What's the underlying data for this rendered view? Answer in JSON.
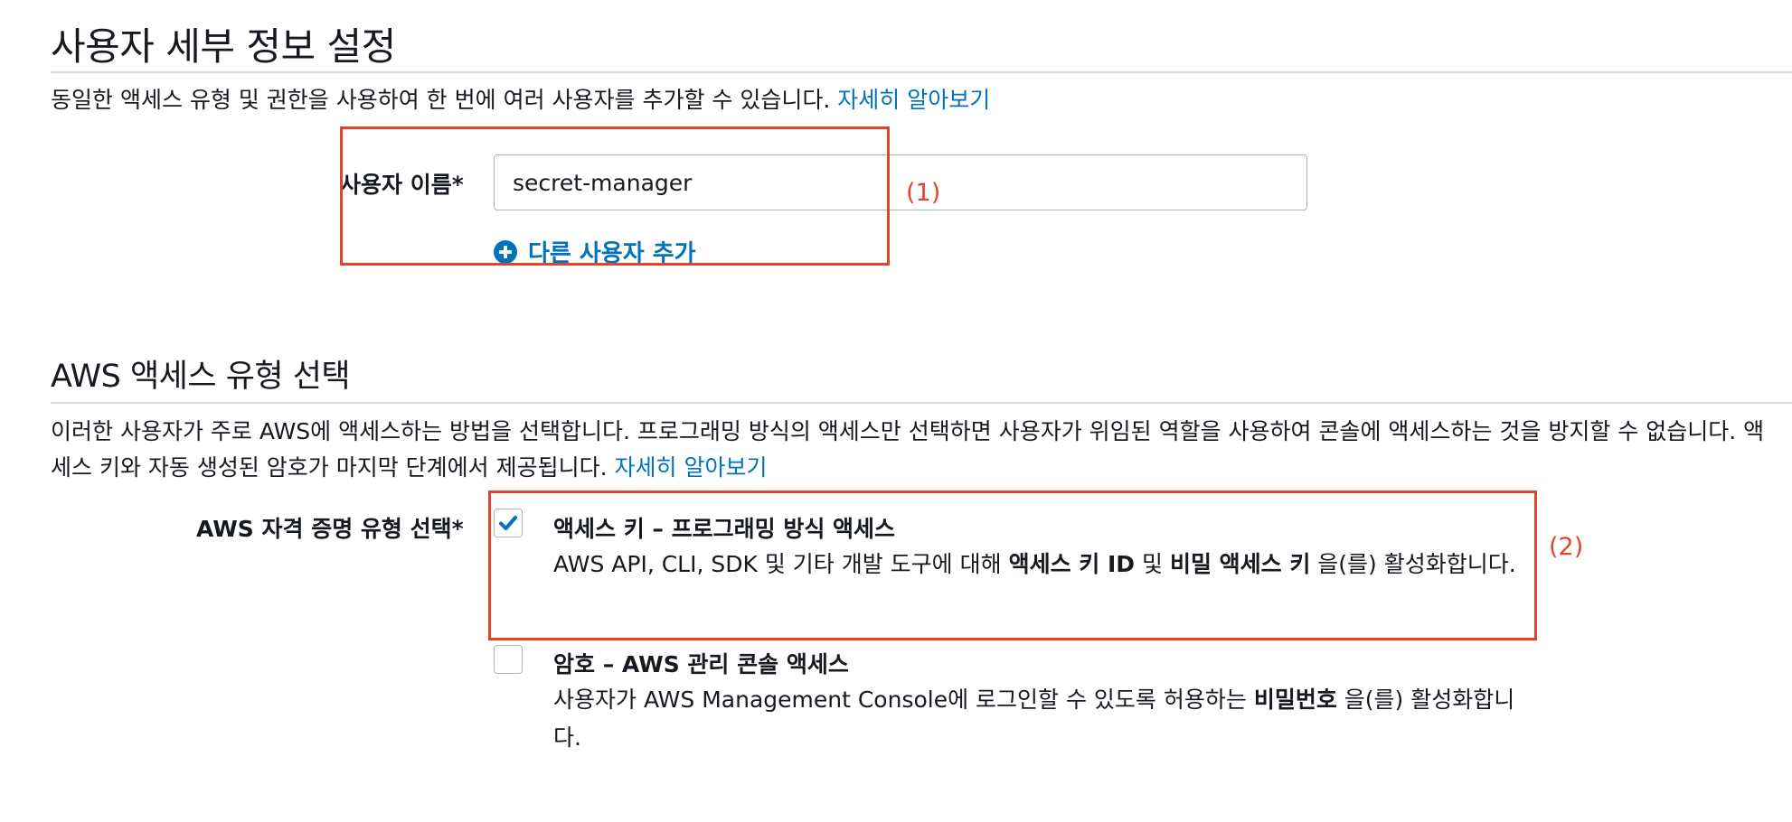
{
  "user_details": {
    "title": "사용자 세부 정보 설정",
    "description": "동일한 액세스 유형 및 권한을 사용하여 한 번에 여러 사용자를 추가할 수 있습니다.",
    "learn_more": "자세히 알아보기",
    "username_label": "사용자 이름*",
    "username_value": "secret-manager",
    "add_user_label": "다른 사용자 추가"
  },
  "access_type": {
    "title": "AWS 액세스 유형 선택",
    "description": "이러한 사용자가 주로 AWS에 액세스하는 방법을 선택합니다. 프로그래밍 방식의 액세스만 선택하면 사용자가 위임된 역할을 사용하여 콘솔에 액세스하는 것을 방지할 수 없습니다. 액세스 키와 자동 생성된 암호가 마지막 단계에서 제공됩니다.",
    "learn_more": "자세히 알아보기",
    "credential_label": "AWS 자격 증명 유형 선택*",
    "options": [
      {
        "title": "액세스 키 – 프로그래밍 방식 액세스",
        "checked": true,
        "desc_prefix": "AWS API, CLI, SDK 및 기타 개발 도구에 대해 ",
        "desc_bold1": "액세스 키 ID",
        "desc_mid": " 및 ",
        "desc_bold2": "비밀 액세스 키",
        "desc_suffix": " 을(를) 활성화합니다."
      },
      {
        "title": "암호 – AWS 관리 콘솔 액세스",
        "checked": false,
        "desc_prefix": "사용자가 AWS Management Console에 로그인할 수 있도록 허용하는 ",
        "desc_bold": "비밀번호",
        "desc_suffix": " 을(를) 활성화합니다."
      }
    ]
  },
  "annotations": [
    "(1)",
    "(2)"
  ],
  "colors": {
    "annotation": "#e0452c",
    "link": "#0073bb",
    "checkbox_checked": "#0073bb"
  }
}
